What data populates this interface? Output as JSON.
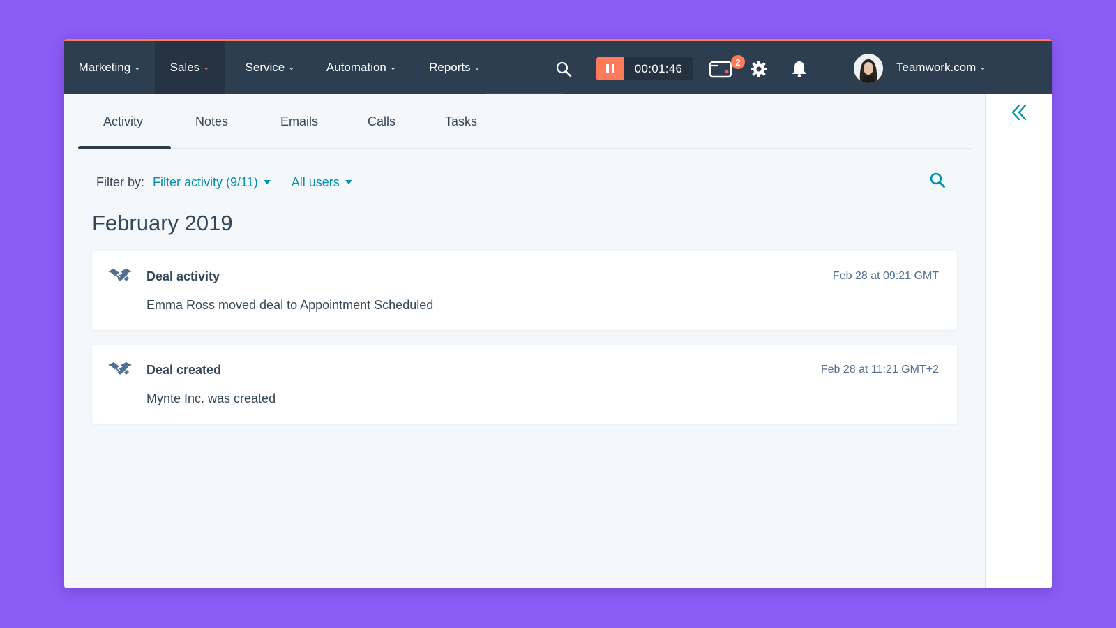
{
  "nav": {
    "items": [
      {
        "label": "Marketing"
      },
      {
        "label": "Sales"
      },
      {
        "label": "Service"
      },
      {
        "label": "Automation"
      },
      {
        "label": "Reports"
      }
    ],
    "timer": "00:01:46",
    "inbox_badge": "2",
    "account": "Teamwork.com"
  },
  "tabs": [
    {
      "label": "Activity"
    },
    {
      "label": "Notes"
    },
    {
      "label": "Emails"
    },
    {
      "label": "Calls"
    },
    {
      "label": "Tasks"
    }
  ],
  "filter": {
    "label": "Filter by:",
    "activity": "Filter activity (9/11)",
    "users": "All users"
  },
  "timeline": {
    "month": "February 2019",
    "cards": [
      {
        "title": "Deal activity",
        "body": "Emma Ross moved deal to Appointment Scheduled",
        "time": "Feb 28 at 09:21 GMT",
        "icon": "handshake-icon"
      },
      {
        "title": "Deal created",
        "body": "Mynte Inc. was created",
        "time": "Feb 28 at 11:21 GMT+2",
        "icon": "handshake-icon"
      }
    ]
  },
  "colors": {
    "background": "#8b5cf6",
    "nav": "#2d3e50",
    "accent": "#ff7a59",
    "link": "#0091ae",
    "text": "#33475b"
  }
}
